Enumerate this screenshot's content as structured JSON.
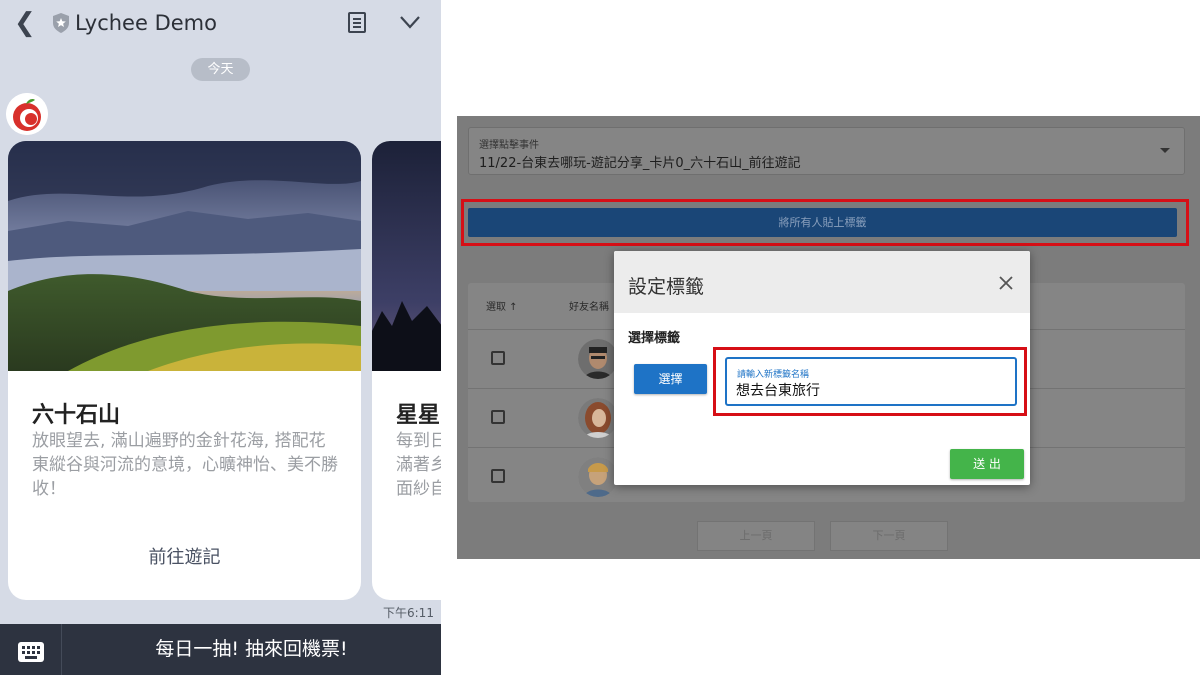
{
  "chat": {
    "title": "Lychee Demo",
    "date_label": "今天",
    "cards": [
      {
        "title": "六十石山",
        "description": "放眼望去, 滿山遍野的金針花海, 搭配花東縱谷與河流的意境，心曠神怡、美不勝收！",
        "link_label": "前往遊記"
      },
      {
        "title": "星星",
        "description_lines": [
          "每到日",
          "滿著乡",
          "面紗自"
        ]
      }
    ],
    "timestamp": "下午6:11",
    "rich_menu_label": "每日一抽! 抽來回機票!",
    "icons": [
      "back-icon",
      "shield-icon",
      "notes-icon",
      "chevron-down-icon",
      "keyboard-icon"
    ]
  },
  "admin": {
    "event_select": {
      "label": "選擇點擊事件",
      "value": "11/22-台東去哪玩-遊記分享_卡片0_六十石山_前往遊記"
    },
    "tag_all_button": "將所有人貼上標籤",
    "table": {
      "headers": [
        "選取 ↑",
        "好友名稱"
      ],
      "rows": [
        {
          "avatar": "friend-avatar-1"
        },
        {
          "avatar": "friend-avatar-2"
        },
        {
          "avatar": "friend-avatar-3"
        }
      ]
    },
    "pager": {
      "prev": "上一頁",
      "next": "下一頁"
    },
    "dialog": {
      "title": "設定標籤",
      "section_label": "選擇標籤",
      "choose_button": "選擇",
      "input_label": "請輸入新標籤名稱",
      "input_value": "想去台東旅行",
      "submit_button": "送 出"
    },
    "colors": {
      "highlight_red": "#d60f16",
      "primary_blue": "#1e73c6",
      "submit_green": "#44b44a"
    }
  }
}
